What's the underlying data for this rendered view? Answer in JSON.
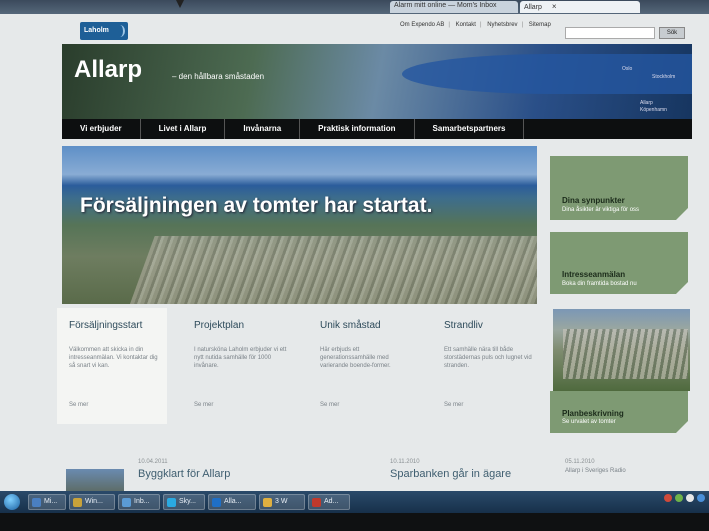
{
  "browser": {
    "tabs": [
      {
        "label": "Alarm mitt online — Mom's Inbox",
        "active": false
      },
      {
        "label": "Allarp",
        "active": true
      }
    ],
    "tab_close": "×"
  },
  "site": {
    "logo": "Laholm",
    "top_links": [
      "Om Expendo AB",
      "Kontakt",
      "Nyhetsbrev",
      "Sitemap"
    ],
    "search_button": "Sök",
    "search_placeholder": ""
  },
  "hero": {
    "title": "Allarp",
    "subtitle": "– den hållbara småstaden",
    "places": [
      "Oslo",
      "Stockholm",
      "Allarp",
      "Köpenhamn"
    ]
  },
  "nav": [
    "Vi erbjuder",
    "Livet i Allarp",
    "Invånarna",
    "Praktisk information",
    "Samarbetspartners"
  ],
  "banner": {
    "headline": "Försäljningen av tomter har startat."
  },
  "promos": [
    {
      "title": "Dina synpunkter",
      "subtitle": "Dina åsikter är viktiga för oss"
    },
    {
      "title": "Intresseanmälan",
      "subtitle": "Boka din framtida bostad nu"
    },
    {
      "title": "Planbeskrivning",
      "subtitle": "Se urvalet av tomter"
    }
  ],
  "columns": [
    {
      "title": "Försäljningsstart",
      "text": "Välkommen att skicka in din intresseanmälan. Vi kontaktar dig så snart vi kan.",
      "more": "Se mer"
    },
    {
      "title": "Projektplan",
      "text": "I natursköna Laholm erbjuder vi ett nytt nutida samhälle för 1000 invånare.",
      "more": "Se mer"
    },
    {
      "title": "Unik småstad",
      "text": "Här erbjuds ett generationssamhälle med varierande boende-former.",
      "more": "Se mer"
    },
    {
      "title": "Strandliv",
      "text": "Ett samhälle nära till både storstädernas puls och lugnet vid stranden.",
      "more": "Se mer"
    }
  ],
  "news": [
    {
      "date": "10.04.2011",
      "headline": "Byggklart för Allarp"
    },
    {
      "date": "10.11.2010",
      "headline": "Sparbanken går in ägare"
    },
    {
      "date": "05.11.2010",
      "headline": "Allarp i Sveriges Radio"
    }
  ],
  "taskbar": {
    "items": [
      "Mi...",
      "Win...",
      "Inb...",
      "Sky...",
      "Alla...",
      "3 W",
      "Ad..."
    ],
    "icon_colors": [
      "#4a7fc1",
      "#c8a23a",
      "#5b9bd5",
      "#2aa9e0",
      "#1f6fc6",
      "#e0b040",
      "#c0392b"
    ]
  }
}
